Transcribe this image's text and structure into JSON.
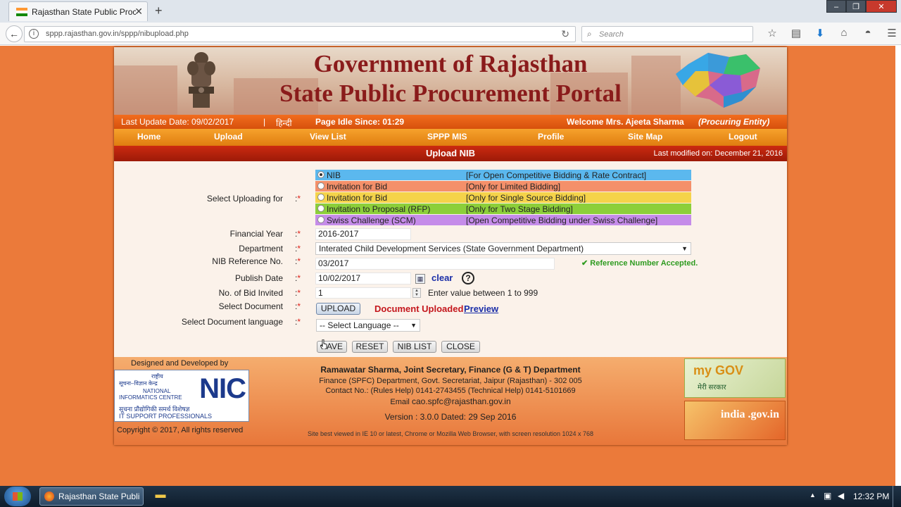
{
  "browser": {
    "tab_title": "Rajasthan State Public Proc...",
    "url": "sppp.rajasthan.gov.in/sppp/nibupload.php",
    "search_placeholder": "Search"
  },
  "banner": {
    "title_line1": "Government of Rajasthan",
    "title_line2": "State Public Procurement Portal"
  },
  "infobar": {
    "last_update": "Last Update Date: 09/02/2017",
    "separator": "|",
    "hindi": "हिन्दी",
    "idle": "Page Idle Since: 01:29",
    "welcome": "Welcome Mrs. Ajeeta Sharma",
    "role": "(Procuring Entity)"
  },
  "menu": {
    "items": [
      {
        "label": "Home"
      },
      {
        "label": "Upload"
      },
      {
        "label": "View List"
      },
      {
        "label": "SPPP MIS"
      },
      {
        "label": "Profile"
      },
      {
        "label": "Site Map"
      },
      {
        "label": "Logout"
      }
    ]
  },
  "titlebar": {
    "title": "Upload NIB",
    "modified": "Last modified on: December 21, 2016"
  },
  "form": {
    "labels": {
      "select_uploading_for": "Select Uploading for",
      "financial_year": "Financial Year",
      "department": "Department",
      "nib_reference": "NIB Reference No.",
      "publish_date": "Publish Date",
      "no_of_bid": "No. of Bid Invited",
      "select_document": "Select Document",
      "document_language": "Select Document language"
    },
    "colon": ":",
    "star": "*",
    "upload_options": [
      {
        "name": "NIB",
        "desc": "[For Open Competitive Bidding & Rate Contract]",
        "color": "#5bb8ee",
        "selected": true
      },
      {
        "name": "Invitation for Bid",
        "desc": "[Only for Limited Bidding]",
        "color": "#f4906a",
        "selected": false
      },
      {
        "name": "Invitation for Bid",
        "desc": "[Only for Single Source Bidding]",
        "color": "#f5d34a",
        "selected": false
      },
      {
        "name": "Invitation to Proposal (RFP)",
        "desc": "[Only for Two Stage Bidding]",
        "color": "#8ccf3a",
        "selected": false
      },
      {
        "name": "Swiss Challenge (SCM)",
        "desc": "[Open Competitive Bidding under Swiss Challenge]",
        "color": "#c58ce9",
        "selected": false
      }
    ],
    "financial_year": "2016-2017",
    "department": "Interated Child Development Services (State Government Department)",
    "nib_reference": "03/2017",
    "reference_ok": "✔ Reference Number Accepted.",
    "publish_date": "10/02/2017",
    "clear_link": "clear",
    "help_symbol": "?",
    "no_of_bid": "1",
    "bid_hint": "Enter value between 1 to 999",
    "upload_button": "UPLOAD",
    "document_uploaded": "Document Uploaded",
    "preview_link": "Preview",
    "language_select": "-- Select Language --",
    "buttons": {
      "save": "SAVE",
      "reset": "RESET",
      "nib_list": "NIB LIST",
      "close": "CLOSE"
    }
  },
  "footer": {
    "designed_by": "Designed and Developed by",
    "nic_text": "NIC",
    "nic_line1": "राष्ट्रीय",
    "nic_line2": "सूचना–विज्ञान केन्द्र",
    "nic_line3": "NATIONAL",
    "nic_line4": "INFORMATICS CENTRE",
    "nic_line5": "सूचना प्रौद्योगिकी समर्थ विशेषज्ञ",
    "nic_line6": "IT SUPPORT PROFESSIONALS",
    "copyright": "Copyright © 2017, All rights reserved",
    "name": "Ramawatar Sharma, Joint Secretary, Finance (G & T) Department",
    "address": "Finance (SPFC) Department, Govt. Secretariat, Jaipur (Rajasthan) - 302 005",
    "contact": "Contact No.: (Rules Help) 0141-2743455 (Technical Help) 0141-5101669",
    "email_label": "Email",
    "email": "cao.spfc@rajasthan.gov.in",
    "version": "Version : 3.0.0 Dated: 29 Sep 2016",
    "best_viewed": "Site best viewed in IE 10 or latest, Chrome or Mozilla Web Browser, with screen resolution 1024 x 768",
    "mygov_text": "my GOV",
    "mygov_sub": "मेरी सरकार",
    "indiagov_text": "india .gov.in"
  },
  "taskbar": {
    "window_title": "Rajasthan State Publi...",
    "clock": "12:32 PM"
  },
  "colors": {
    "accent_orange": "#e8773a",
    "menu_orange": "#f29a24",
    "title_red": "#b0200c",
    "banner_title": "#8a1b1b"
  }
}
